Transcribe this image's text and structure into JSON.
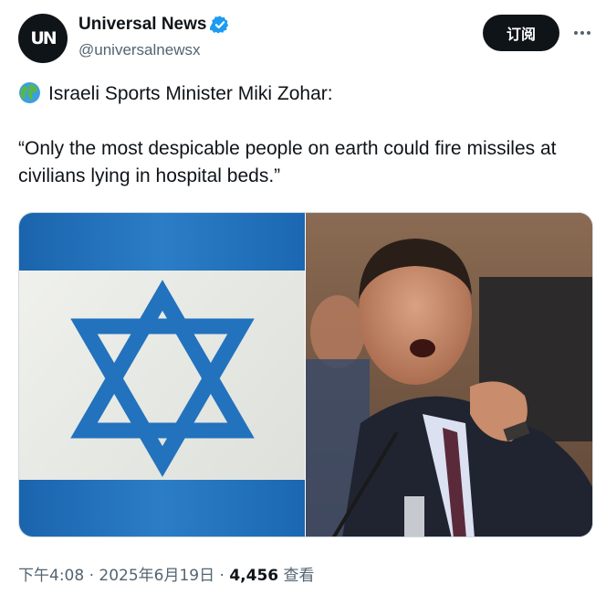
{
  "author": {
    "avatar_text": "UN",
    "display_name": "Universal News",
    "handle": "@universalnewsx"
  },
  "actions": {
    "subscribe_label": "订阅"
  },
  "tweet": {
    "line1": "Israeli Sports Minister Miki Zohar:",
    "line2": "“Only the most despicable people on earth could fire missiles at civilians lying in hospital beds.”"
  },
  "meta": {
    "time": "下午4:08",
    "sep1": " · ",
    "date": "2025年6月19日",
    "sep2": " · ",
    "views_count": "4,456",
    "views_label": " 查看"
  },
  "colors": {
    "verified_blue": "#1d9bf0",
    "flag_blue": "#1f6fb8",
    "text_secondary": "#536471"
  },
  "icons": {
    "verified": "verified-badge-icon",
    "globe": "globe-emoji-icon",
    "more": "more-options-icon"
  }
}
